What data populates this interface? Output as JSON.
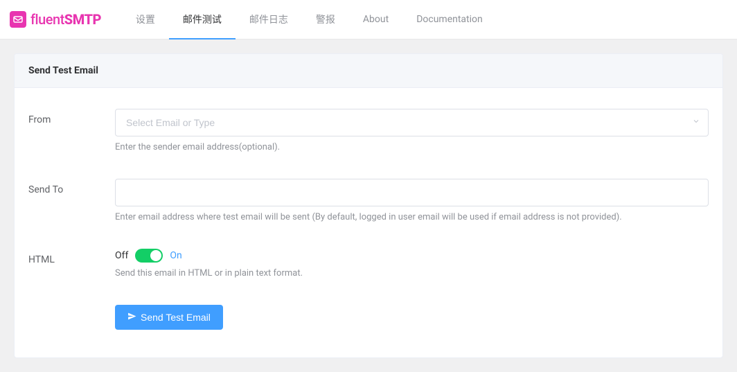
{
  "brand": {
    "name_light": "fluent",
    "name_bold": "SMTP"
  },
  "nav": {
    "items": [
      {
        "label": "设置"
      },
      {
        "label": "邮件测试"
      },
      {
        "label": "邮件日志"
      },
      {
        "label": "警报"
      },
      {
        "label": "About"
      },
      {
        "label": "Documentation"
      }
    ],
    "active_index": 1
  },
  "card": {
    "title": "Send Test Email"
  },
  "form": {
    "from": {
      "label": "From",
      "placeholder": "Select Email or Type",
      "hint": "Enter the sender email address(optional)."
    },
    "send_to": {
      "label": "Send To",
      "value": "",
      "hint": "Enter email address where test email will be sent (By default, logged in user email will be used if email address is not provided)."
    },
    "html": {
      "label": "HTML",
      "off": "Off",
      "on": "On",
      "state": "on",
      "hint": "Send this email in HTML or in plain text format."
    },
    "submit": {
      "label": "Send Test Email"
    }
  }
}
